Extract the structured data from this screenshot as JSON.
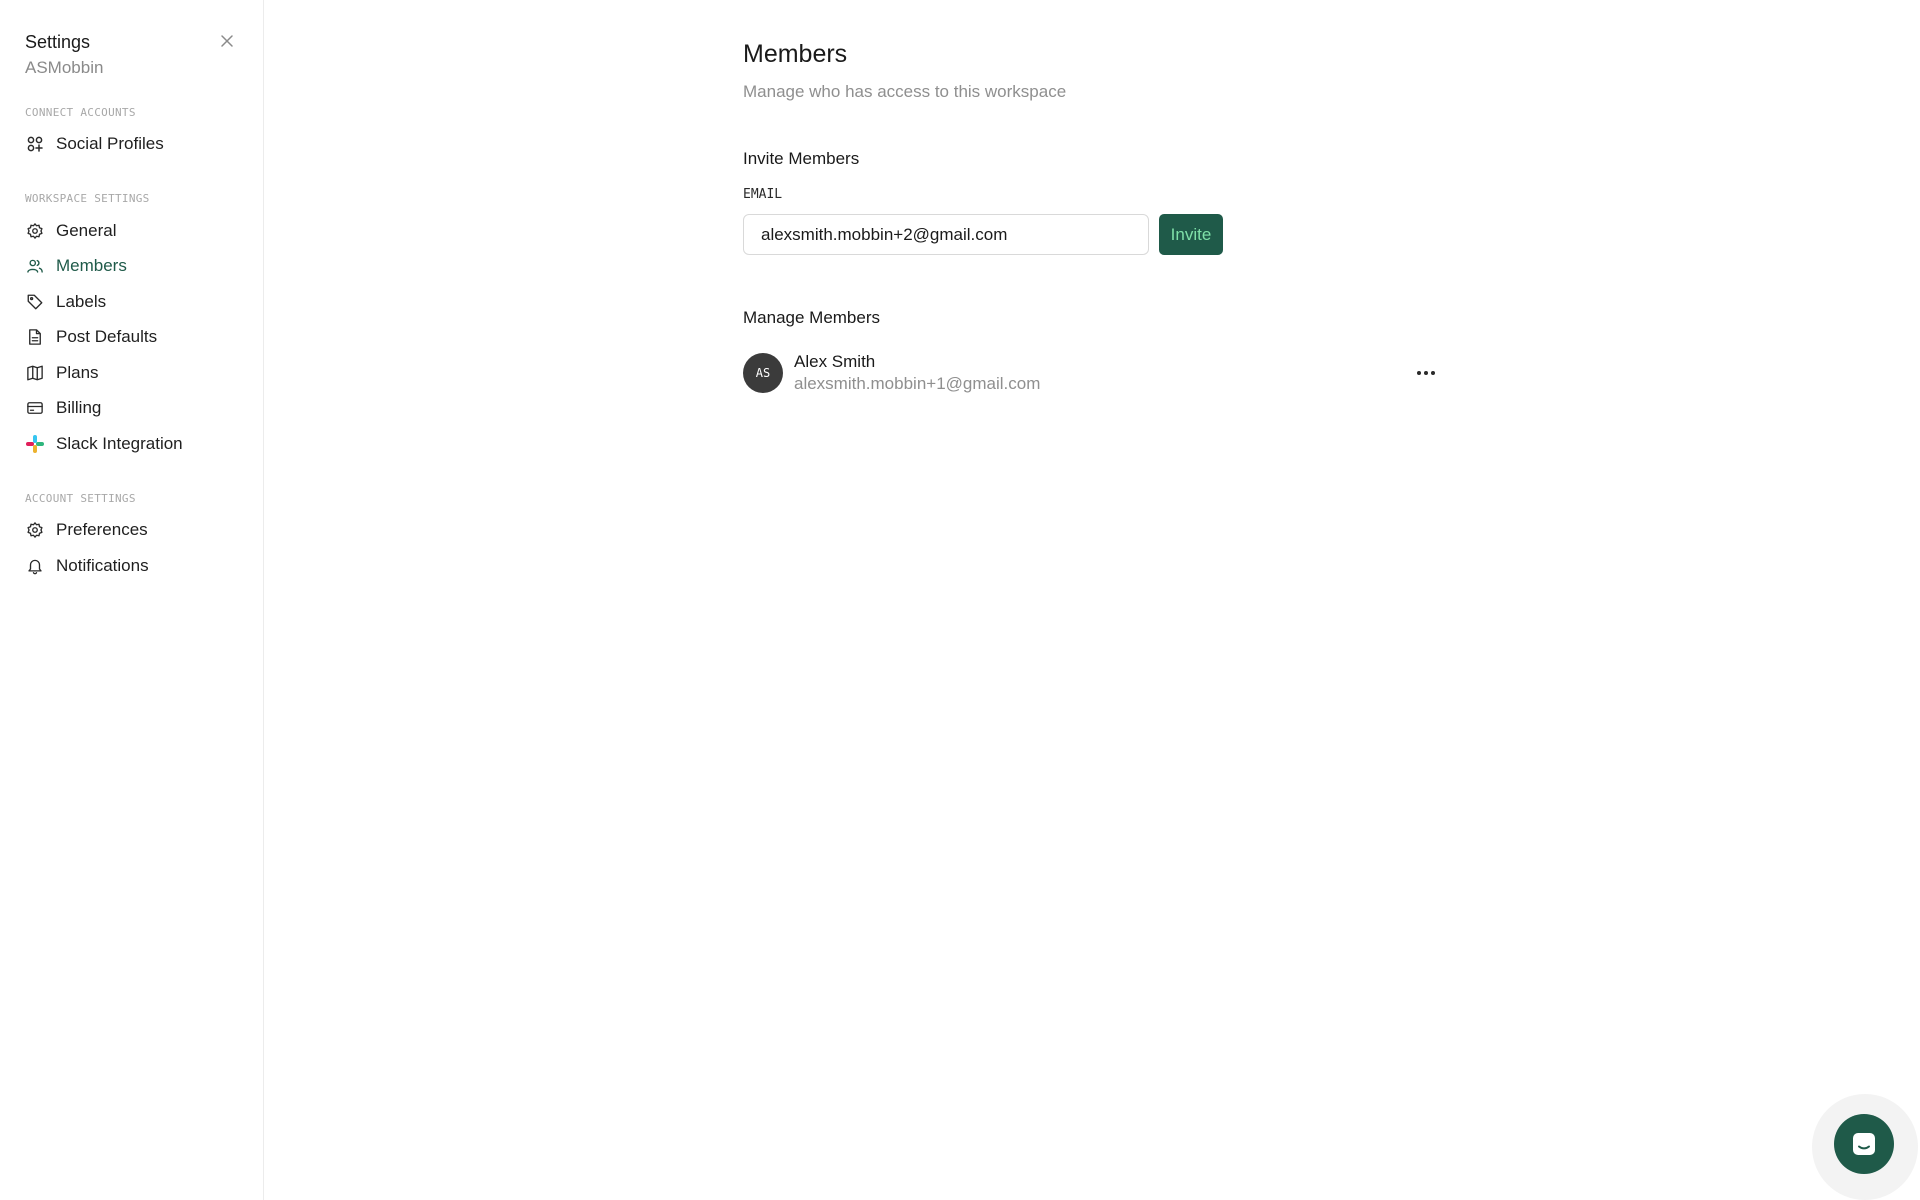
{
  "sidebar": {
    "title": "Settings",
    "workspace": "ASMobbin",
    "sections": {
      "connect": "CONNECT ACCOUNTS",
      "workspace": "WORKSPACE SETTINGS",
      "account": "ACCOUNT SETTINGS"
    },
    "items": [
      {
        "label": "Social Profiles",
        "icon": "social-profiles-icon"
      },
      {
        "label": "General",
        "icon": "gear-icon"
      },
      {
        "label": "Members",
        "icon": "users-icon",
        "active": true
      },
      {
        "label": "Labels",
        "icon": "tag-icon"
      },
      {
        "label": "Post Defaults",
        "icon": "document-icon"
      },
      {
        "label": "Plans",
        "icon": "map-icon"
      },
      {
        "label": "Billing",
        "icon": "credit-card-icon"
      },
      {
        "label": "Slack Integration",
        "icon": "slack-icon"
      },
      {
        "label": "Preferences",
        "icon": "gear-icon"
      },
      {
        "label": "Notifications",
        "icon": "bell-icon"
      }
    ]
  },
  "main": {
    "title": "Members",
    "subtitle": "Manage who has access to this workspace",
    "invite": {
      "heading": "Invite Members",
      "field_label": "EMAIL",
      "email_value": "alexsmith.mobbin+2@gmail.com",
      "button_label": "Invite"
    },
    "manage": {
      "heading": "Manage Members",
      "members": [
        {
          "initials": "AS",
          "name": "Alex Smith",
          "email": "alexsmith.mobbin+1@gmail.com"
        }
      ]
    }
  },
  "colors": {
    "accent": "#1f5a49",
    "accent_text": "#7fe0a8",
    "muted_text": "#8f8f8f",
    "avatar_bg": "#3b3b3b"
  }
}
